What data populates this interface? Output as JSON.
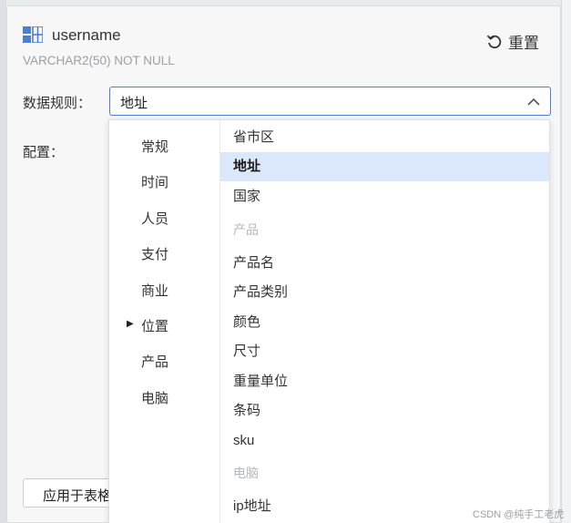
{
  "column": {
    "name": "username",
    "type": "VARCHAR2(50) NOT NULL",
    "icon": "table-column-icon"
  },
  "header": {
    "reset_label": "重置",
    "reset_icon": "reset-icon"
  },
  "form": {
    "rule_label": "数据规则：",
    "config_label": "配置：",
    "rule_value": "地址",
    "apply_label": "应用于表格"
  },
  "dropdown": {
    "categories": [
      {
        "label": "常规"
      },
      {
        "label": "时间"
      },
      {
        "label": "人员"
      },
      {
        "label": "支付"
      },
      {
        "label": "商业"
      },
      {
        "label": "位置",
        "active": true
      },
      {
        "label": "产品"
      },
      {
        "label": "电脑"
      }
    ],
    "options": [
      {
        "label": "省市区"
      },
      {
        "label": "地址",
        "selected": true
      },
      {
        "label": "国家"
      },
      {
        "label": "产品",
        "group": true
      },
      {
        "label": "产品名"
      },
      {
        "label": "产品类别"
      },
      {
        "label": "颜色"
      },
      {
        "label": "尺寸"
      },
      {
        "label": "重量单位"
      },
      {
        "label": "条码"
      },
      {
        "label": "sku"
      },
      {
        "label": "电脑",
        "group": true
      },
      {
        "label": "ip地址"
      }
    ]
  },
  "watermark": "CSDN @纯手工老虎",
  "colors": {
    "accent": "#4a7fd6",
    "selected_bg": "#dbe7fb",
    "group_text": "#b5b8bd"
  }
}
